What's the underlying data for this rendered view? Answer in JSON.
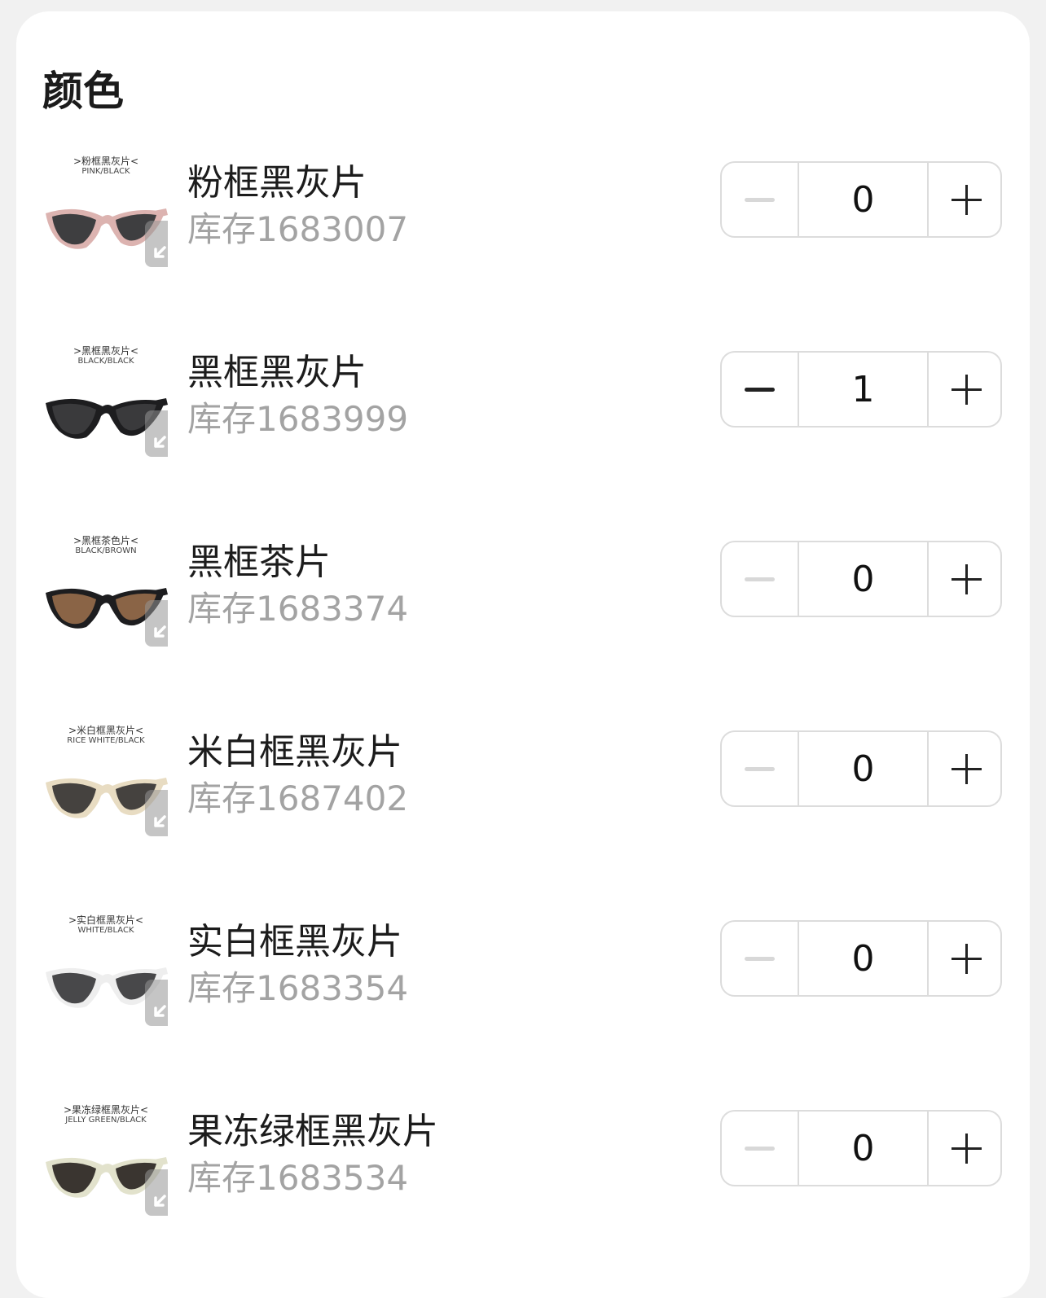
{
  "section": {
    "title": "颜色"
  },
  "items": [
    {
      "thumb_cn": ">粉框黑灰片<",
      "thumb_en": "PINK/BLACK",
      "name": "粉框黑灰片",
      "stock": "库存1683007",
      "qty": "0",
      "frame_color": "#dcb3b0",
      "lens_color": "#3e3e40",
      "minus_enabled": false
    },
    {
      "thumb_cn": ">黑框黑灰片<",
      "thumb_en": "BLACK/BLACK",
      "name": "黑框黑灰片",
      "stock": "库存1683999",
      "qty": "1",
      "frame_color": "#1d1d1f",
      "lens_color": "#3a3a3c",
      "minus_enabled": true
    },
    {
      "thumb_cn": ">黑框茶色片<",
      "thumb_en": "BLACK/BROWN",
      "name": "黑框茶片",
      "stock": "库存1683374",
      "qty": "0",
      "frame_color": "#1d1d1f",
      "lens_color": "#8a6446",
      "minus_enabled": false
    },
    {
      "thumb_cn": ">米白框黑灰片<",
      "thumb_en": "RICE WHITE/BLACK",
      "name": "米白框黑灰片",
      "stock": "库存1687402",
      "qty": "0",
      "frame_color": "#e8dcc2",
      "lens_color": "#45423f",
      "minus_enabled": false
    },
    {
      "thumb_cn": ">实白框黑灰片<",
      "thumb_en": "WHITE/BLACK",
      "name": "实白框黑灰片",
      "stock": "库存1683354",
      "qty": "0",
      "frame_color": "#eeeeee",
      "lens_color": "#48484a",
      "minus_enabled": false
    },
    {
      "thumb_cn": ">果冻绿框黑灰片<",
      "thumb_en": "JELLY GREEN/BLACK",
      "name": "果冻绿框黑灰片",
      "stock": "库存1683534",
      "qty": "0",
      "frame_color": "#e2e2cc",
      "lens_color": "#3a3530",
      "minus_enabled": false
    }
  ]
}
